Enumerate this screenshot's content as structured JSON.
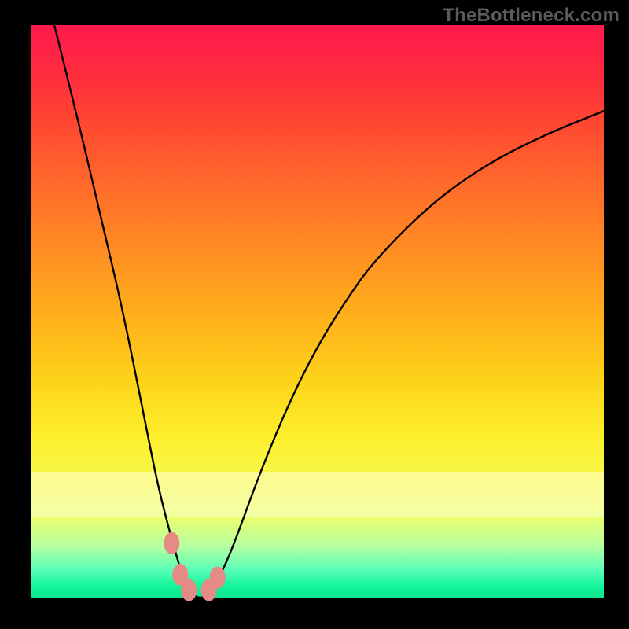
{
  "watermark": "TheBottleneck.com",
  "colors": {
    "frame": "#000000",
    "curve": "#000000",
    "marker": "#e58a84",
    "watermark": "#5b5b5b"
  },
  "chart_data": {
    "type": "line",
    "title": "",
    "xlabel": "",
    "ylabel": "",
    "xlim": [
      0,
      100
    ],
    "ylim": [
      0,
      100
    ],
    "grid": false,
    "legend": false,
    "note": "V-shaped bottleneck curve. x ≈ component balance parameter (arbitrary 0–100). y ≈ bottleneck percentage (0 = no bottleneck, 100 = full bottleneck). Minimum ≈ x 27–32, y ≈ 0. Values estimated from pixel positions; no axis ticks are drawn.",
    "series": [
      {
        "name": "bottleneck-curve",
        "x": [
          4,
          8,
          12,
          16,
          20,
          22,
          24,
          26,
          27,
          28,
          29,
          30,
          31,
          32,
          34,
          36,
          40,
          45,
          50,
          55,
          60,
          70,
          80,
          90,
          100
        ],
        "y": [
          100,
          84,
          67,
          50,
          30,
          20,
          12,
          5,
          2,
          0.6,
          0,
          0,
          0.6,
          2,
          6,
          11,
          22,
          34,
          44,
          52,
          59,
          69,
          76,
          81,
          85
        ]
      }
    ],
    "markers": {
      "name": "highlight-dots",
      "x": [
        24.5,
        26.0,
        27.5,
        31.0,
        32.5
      ],
      "y": [
        9.5,
        4.0,
        1.3,
        1.3,
        3.5
      ]
    },
    "pale_band_y": [
      14,
      22
    ]
  }
}
